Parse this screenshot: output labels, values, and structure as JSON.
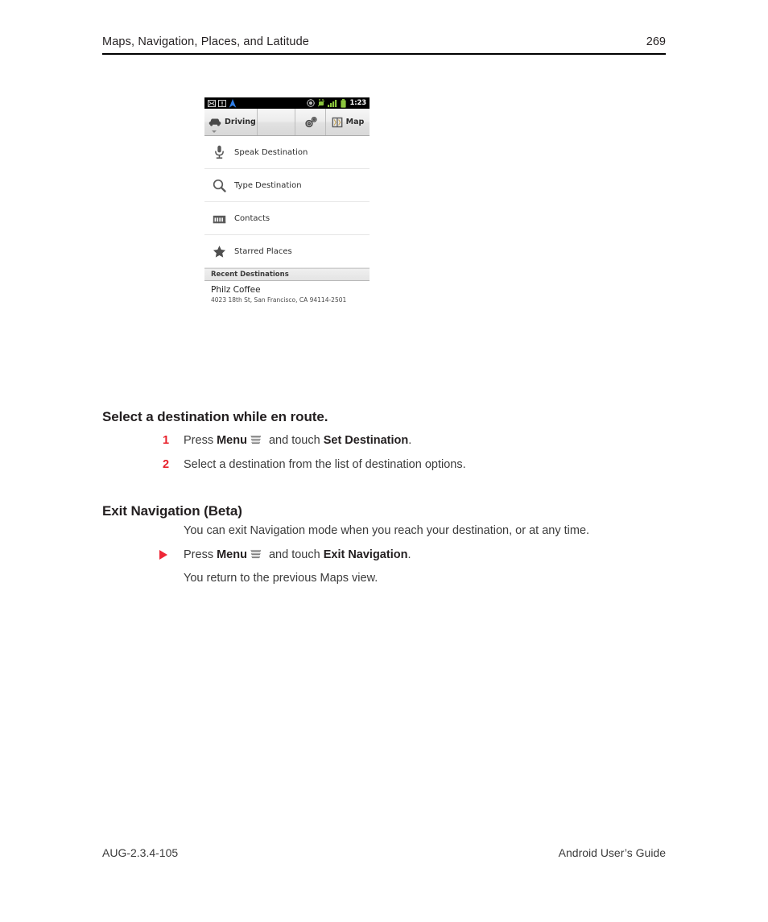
{
  "header": {
    "title": "Maps, Navigation, Places, and Latitude",
    "page_number": "269"
  },
  "figure": {
    "name": "android-navigation-set-destination-screenshot",
    "status_bar": {
      "time": "1:23",
      "left_icons": [
        "email-icon",
        "sms-icon",
        "navigation-arrow-icon"
      ],
      "right_icons": [
        "gps-icon",
        "usb-debug-icon",
        "signal-icon",
        "battery-icon"
      ]
    },
    "action_bar": {
      "mode_label": "Driving",
      "mode_icon": "car-icon",
      "settings_icon": "settings-gears-icon",
      "map_label": "Map",
      "map_icon": "map-icon"
    },
    "list_items": [
      {
        "label": "Speak Destination",
        "icon": "microphone-icon"
      },
      {
        "label": "Type Destination",
        "icon": "search-icon"
      },
      {
        "label": "Contacts",
        "icon": "contacts-icon"
      },
      {
        "label": "Starred Places",
        "icon": "star-icon"
      }
    ],
    "section_header": "Recent Destinations",
    "recent": {
      "title": "Philz Coffee",
      "address": "4023 18th St, San Francisco, CA 94114-2501"
    }
  },
  "sections": {
    "select_destination": {
      "heading": "Select a destination while en route.",
      "steps": [
        {
          "number": "1",
          "pre": "Press ",
          "bold1": "Menu",
          "mid": " and touch ",
          "bold2": "Set Destination",
          "post": "."
        },
        {
          "number": "2",
          "pre": "Select a destination from the list of destination options.",
          "bold1": "",
          "mid": "",
          "bold2": "",
          "post": ""
        }
      ]
    },
    "exit_navigation": {
      "heading": "Exit Navigation (Beta)",
      "intro": "You can exit Navigation mode when you reach your destination, or at any time.",
      "bullet": {
        "pre": "Press ",
        "bold1": "Menu",
        "mid": " and touch ",
        "bold2": "Exit Navigation",
        "post": "."
      },
      "outro": "You return to the previous Maps view."
    }
  },
  "footer": {
    "doc_id": "AUG-2.3.4-105",
    "guide_name": "Android User’s Guide"
  },
  "colors": {
    "accent_red": "#e8202a",
    "bullet_red": "#ee2737",
    "text": "#231f20",
    "body_text": "#3b3b3b"
  }
}
